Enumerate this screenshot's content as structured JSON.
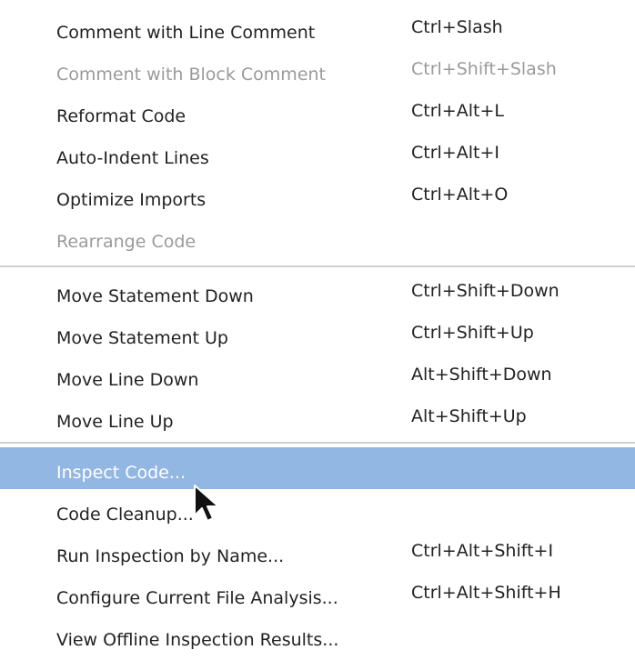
{
  "menu": {
    "items": [
      {
        "label": "Comment with Line Comment",
        "shortcut": "Ctrl+Slash",
        "mnemonic": "L",
        "enabled": true
      },
      {
        "label": "Comment with Block Comment",
        "shortcut": "Ctrl+Shift+Slash",
        "mnemonic": "B",
        "enabled": false
      },
      {
        "label": "Reformat Code",
        "shortcut": "Ctrl+Alt+L",
        "mnemonic": "R",
        "enabled": true
      },
      {
        "label": "Auto-Indent Lines",
        "shortcut": "Ctrl+Alt+I",
        "mnemonic": "A",
        "enabled": true
      },
      {
        "label": "Optimize Imports",
        "shortcut": "Ctrl+Alt+O",
        "mnemonic": "z",
        "enabled": true
      },
      {
        "label": "Rearrange Code",
        "shortcut": "",
        "mnemonic": "",
        "enabled": false
      },
      {
        "label": "Move Statement Down",
        "shortcut": "Ctrl+Shift+Down",
        "mnemonic": "w",
        "enabled": true
      },
      {
        "label": "Move Statement Up",
        "shortcut": "Ctrl+Shift+Up",
        "mnemonic": "U",
        "enabled": true
      },
      {
        "label": "Move Line Down",
        "shortcut": "Alt+Shift+Down",
        "mnemonic": "w",
        "enabled": true
      },
      {
        "label": "Move Line Up",
        "shortcut": "Alt+Shift+Up",
        "mnemonic": "U",
        "enabled": true
      },
      {
        "label": "Inspect Code...",
        "shortcut": "",
        "mnemonic": "I",
        "enabled": true,
        "selected": true
      },
      {
        "label": "Code Cleanup...",
        "shortcut": "",
        "mnemonic": "C",
        "enabled": true
      },
      {
        "label": "Run Inspection by Name...",
        "shortcut": "Ctrl+Alt+Shift+I",
        "mnemonic": "R",
        "enabled": true
      },
      {
        "label": "Configure Current File Analysis...",
        "shortcut": "Ctrl+Alt+Shift+H",
        "mnemonic": "",
        "enabled": true
      },
      {
        "label": "View Offline Inspection Results...",
        "shortcut": "",
        "mnemonic": "O",
        "enabled": true
      }
    ]
  },
  "colors": {
    "selected_background": "#93b7e3",
    "disabled_text": "#9a9a9a",
    "separator": "#cfcfcf"
  },
  "icons": {
    "cursor": "mouse-pointer-icon"
  }
}
